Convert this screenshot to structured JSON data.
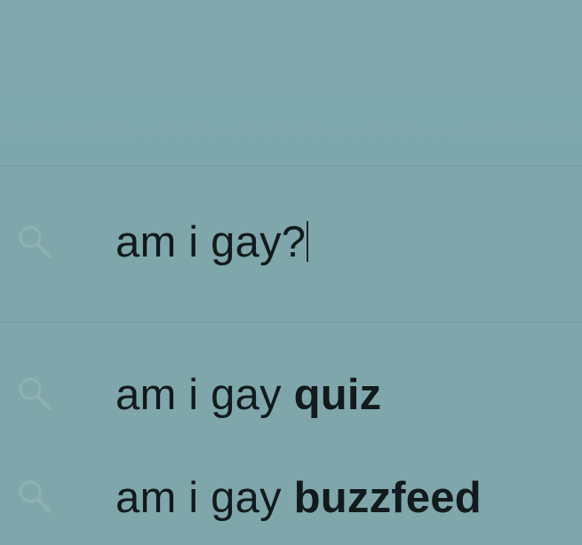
{
  "search": {
    "query": "am i gay?",
    "icon": "search-icon"
  },
  "suggestions": [
    {
      "prefix": "am i gay ",
      "completion": "quiz",
      "icon": "search-icon"
    },
    {
      "prefix": "am i gay ",
      "completion": "buzzfeed",
      "icon": "search-icon"
    }
  ],
  "colors": {
    "background": "#7fa7ab",
    "text": "#111a1c",
    "icon": "#8fb0b3"
  }
}
